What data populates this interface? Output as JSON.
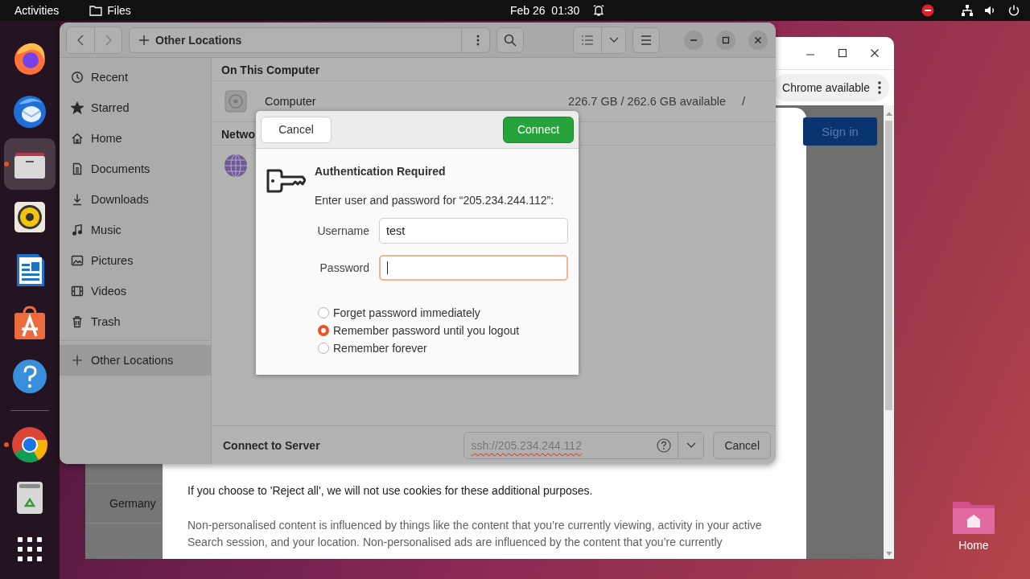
{
  "top_bar": {
    "activities": "Activities",
    "app": "Files",
    "clock": "Feb 26  01:30"
  },
  "dock": {
    "apps": [
      {
        "kind": "firefox",
        "running": false,
        "selected": false
      },
      {
        "kind": "thunderbird",
        "running": false,
        "selected": false
      },
      {
        "kind": "files",
        "running": true,
        "selected": true
      },
      {
        "kind": "rhythmbox",
        "running": false,
        "selected": false
      },
      {
        "kind": "writer",
        "running": false,
        "selected": false
      },
      {
        "kind": "appcenter",
        "running": false,
        "selected": false
      },
      {
        "kind": "help",
        "running": false,
        "selected": false
      }
    ],
    "extras": [
      {
        "kind": "chrome",
        "running": true,
        "selected": false
      },
      {
        "kind": "trash",
        "running": false,
        "selected": false
      }
    ]
  },
  "browser": {
    "menu_text": "Chrome available",
    "sign_in": "Sign in",
    "side_cell": "Germany",
    "paragraphs": [
      {
        "kind": "lead",
        "text": "If you choose to 'Reject all', we will not use cookies for these additional purposes."
      },
      {
        "kind": "body",
        "text": "Non-personalised content is influenced by things like the content that you’re currently viewing, activity in your active Search session, and your location. Non-personalised ads are influenced by the content that you’re currently"
      }
    ]
  },
  "files": {
    "location": "Other Locations",
    "sidebar": [
      {
        "kind": "recent",
        "label": "Recent",
        "selected": false
      },
      {
        "kind": "starred",
        "label": "Starred",
        "selected": false
      },
      {
        "kind": "home",
        "label": "Home",
        "selected": false
      },
      {
        "kind": "documents",
        "label": "Documents",
        "selected": false
      },
      {
        "kind": "downloads",
        "label": "Downloads",
        "selected": false
      },
      {
        "kind": "music",
        "label": "Music",
        "selected": false
      },
      {
        "kind": "pictures",
        "label": "Pictures",
        "selected": false
      },
      {
        "kind": "videos",
        "label": "Videos",
        "selected": false
      },
      {
        "kind": "trash",
        "label": "Trash",
        "selected": false
      }
    ],
    "other_locations": {
      "label": "Other Locations",
      "selected": true
    },
    "on_this_computer": {
      "title": "On This Computer",
      "items": [
        {
          "name": "Computer",
          "space": "226.7 GB / 262.6 GB available",
          "mount": "/"
        }
      ]
    },
    "networks": {
      "title": "Netwo"
    },
    "connect_bar": {
      "label": "Connect to Server",
      "address": "ssh://205.234.244.112",
      "cancel": "Cancel"
    }
  },
  "dialog": {
    "cancel": "Cancel",
    "connect": "Connect",
    "title": "Authentication Required",
    "message": "Enter user and password for “205.234.244.112”:",
    "username": {
      "label": "Username",
      "value": "test",
      "focused": false
    },
    "password": {
      "label": "Password",
      "focused": true
    },
    "options": [
      {
        "label": "Forget password immediately",
        "selected": false
      },
      {
        "label": "Remember password until you logout",
        "selected": true
      },
      {
        "label": "Remember forever",
        "selected": false
      }
    ]
  },
  "desktop": {
    "home_label": "Home"
  }
}
